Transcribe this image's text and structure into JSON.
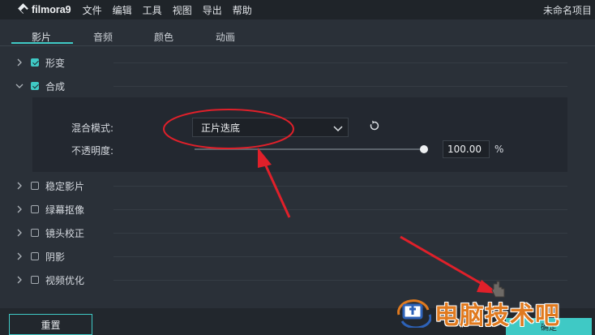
{
  "app": {
    "logo_text": "filmora9",
    "menu": [
      "文件",
      "编辑",
      "工具",
      "视图",
      "导出",
      "帮助"
    ],
    "project_title": "未命名项目"
  },
  "tabs": [
    "影片",
    "音频",
    "颜色",
    "动画"
  ],
  "active_tab": "影片",
  "sections": [
    {
      "label": "形变",
      "checked": true,
      "expanded": false
    },
    {
      "label": "合成",
      "checked": true,
      "expanded": true
    },
    {
      "label": "稳定影片",
      "checked": false,
      "expanded": false
    },
    {
      "label": "绿幕抠像",
      "checked": false,
      "expanded": false
    },
    {
      "label": "镜头校正",
      "checked": false,
      "expanded": false
    },
    {
      "label": "阴影",
      "checked": false,
      "expanded": false
    },
    {
      "label": "视频优化",
      "checked": false,
      "expanded": false
    }
  ],
  "composite": {
    "blend_label": "混合模式:",
    "blend_value": "正片迭底",
    "opacity_label": "不透明度:",
    "opacity_value": "100.00",
    "opacity_unit": "%",
    "opacity_level": 1.0
  },
  "buttons": {
    "reset": "重置",
    "ok": "确定"
  },
  "watermark": "电脑技术吧",
  "colors": {
    "accent": "#3fc9c5",
    "annotation": "#e0202a",
    "watermark": "#e07a1f"
  }
}
